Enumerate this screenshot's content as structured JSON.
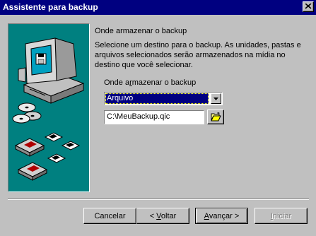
{
  "window": {
    "title": "Assistente para backup"
  },
  "page": {
    "heading": "Onde armazenar o backup",
    "description": "Selecione um destino para o backup. As unidades, pastas e arquivos selecionados serão armazenados na mídia no destino que você selecionar."
  },
  "destination": {
    "label_pre": "Onde a",
    "label_accel": "r",
    "label_post": "mazenar o backup",
    "selected": "Arquivo",
    "path_value": "C:\\MeuBackup.qic"
  },
  "buttons": {
    "cancel": "Cancelar",
    "back_pre": "< ",
    "back_accel": "V",
    "back_post": "oltar",
    "next_pre": "",
    "next_accel": "A",
    "next_post": "vançar >",
    "start_pre": "",
    "start_accel": "I",
    "start_post": "niciar"
  },
  "icons": {
    "close": "close-icon",
    "dropdown": "chevron-down-icon",
    "browse": "open-folder-icon",
    "illustration": "backup-computer-illustration"
  },
  "colors": {
    "titlebar": "#000080",
    "panel": "#008080",
    "face": "#c0c0c0",
    "selection": "#000080"
  }
}
